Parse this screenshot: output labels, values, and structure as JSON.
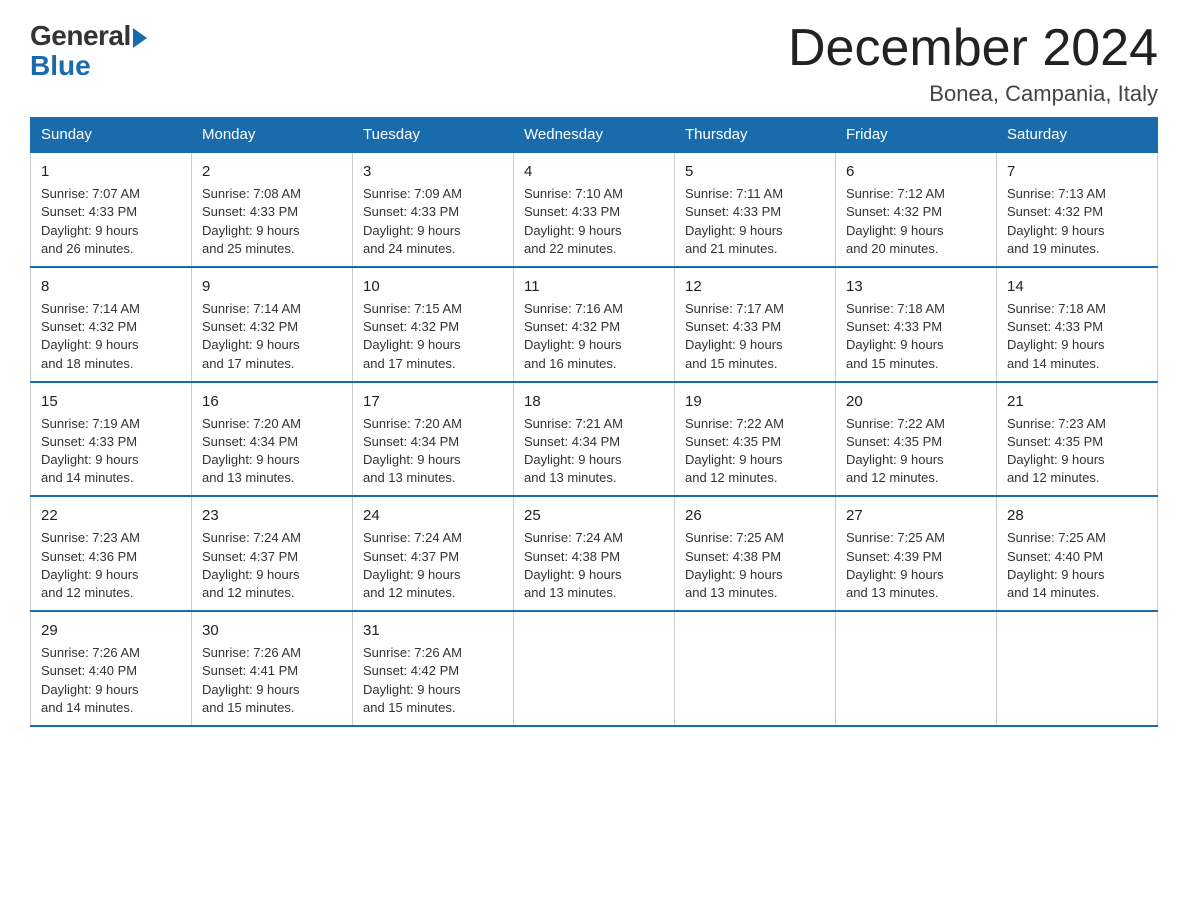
{
  "header": {
    "logo_general": "General",
    "logo_blue": "Blue",
    "month_title": "December 2024",
    "location": "Bonea, Campania, Italy"
  },
  "days_of_week": [
    "Sunday",
    "Monday",
    "Tuesday",
    "Wednesday",
    "Thursday",
    "Friday",
    "Saturday"
  ],
  "weeks": [
    [
      {
        "day": "1",
        "sunrise": "7:07 AM",
        "sunset": "4:33 PM",
        "daylight": "9 hours and 26 minutes."
      },
      {
        "day": "2",
        "sunrise": "7:08 AM",
        "sunset": "4:33 PM",
        "daylight": "9 hours and 25 minutes."
      },
      {
        "day": "3",
        "sunrise": "7:09 AM",
        "sunset": "4:33 PM",
        "daylight": "9 hours and 24 minutes."
      },
      {
        "day": "4",
        "sunrise": "7:10 AM",
        "sunset": "4:33 PM",
        "daylight": "9 hours and 22 minutes."
      },
      {
        "day": "5",
        "sunrise": "7:11 AM",
        "sunset": "4:33 PM",
        "daylight": "9 hours and 21 minutes."
      },
      {
        "day": "6",
        "sunrise": "7:12 AM",
        "sunset": "4:32 PM",
        "daylight": "9 hours and 20 minutes."
      },
      {
        "day": "7",
        "sunrise": "7:13 AM",
        "sunset": "4:32 PM",
        "daylight": "9 hours and 19 minutes."
      }
    ],
    [
      {
        "day": "8",
        "sunrise": "7:14 AM",
        "sunset": "4:32 PM",
        "daylight": "9 hours and 18 minutes."
      },
      {
        "day": "9",
        "sunrise": "7:14 AM",
        "sunset": "4:32 PM",
        "daylight": "9 hours and 17 minutes."
      },
      {
        "day": "10",
        "sunrise": "7:15 AM",
        "sunset": "4:32 PM",
        "daylight": "9 hours and 17 minutes."
      },
      {
        "day": "11",
        "sunrise": "7:16 AM",
        "sunset": "4:32 PM",
        "daylight": "9 hours and 16 minutes."
      },
      {
        "day": "12",
        "sunrise": "7:17 AM",
        "sunset": "4:33 PM",
        "daylight": "9 hours and 15 minutes."
      },
      {
        "day": "13",
        "sunrise": "7:18 AM",
        "sunset": "4:33 PM",
        "daylight": "9 hours and 15 minutes."
      },
      {
        "day": "14",
        "sunrise": "7:18 AM",
        "sunset": "4:33 PM",
        "daylight": "9 hours and 14 minutes."
      }
    ],
    [
      {
        "day": "15",
        "sunrise": "7:19 AM",
        "sunset": "4:33 PM",
        "daylight": "9 hours and 14 minutes."
      },
      {
        "day": "16",
        "sunrise": "7:20 AM",
        "sunset": "4:34 PM",
        "daylight": "9 hours and 13 minutes."
      },
      {
        "day": "17",
        "sunrise": "7:20 AM",
        "sunset": "4:34 PM",
        "daylight": "9 hours and 13 minutes."
      },
      {
        "day": "18",
        "sunrise": "7:21 AM",
        "sunset": "4:34 PM",
        "daylight": "9 hours and 13 minutes."
      },
      {
        "day": "19",
        "sunrise": "7:22 AM",
        "sunset": "4:35 PM",
        "daylight": "9 hours and 12 minutes."
      },
      {
        "day": "20",
        "sunrise": "7:22 AM",
        "sunset": "4:35 PM",
        "daylight": "9 hours and 12 minutes."
      },
      {
        "day": "21",
        "sunrise": "7:23 AM",
        "sunset": "4:35 PM",
        "daylight": "9 hours and 12 minutes."
      }
    ],
    [
      {
        "day": "22",
        "sunrise": "7:23 AM",
        "sunset": "4:36 PM",
        "daylight": "9 hours and 12 minutes."
      },
      {
        "day": "23",
        "sunrise": "7:24 AM",
        "sunset": "4:37 PM",
        "daylight": "9 hours and 12 minutes."
      },
      {
        "day": "24",
        "sunrise": "7:24 AM",
        "sunset": "4:37 PM",
        "daylight": "9 hours and 12 minutes."
      },
      {
        "day": "25",
        "sunrise": "7:24 AM",
        "sunset": "4:38 PM",
        "daylight": "9 hours and 13 minutes."
      },
      {
        "day": "26",
        "sunrise": "7:25 AM",
        "sunset": "4:38 PM",
        "daylight": "9 hours and 13 minutes."
      },
      {
        "day": "27",
        "sunrise": "7:25 AM",
        "sunset": "4:39 PM",
        "daylight": "9 hours and 13 minutes."
      },
      {
        "day": "28",
        "sunrise": "7:25 AM",
        "sunset": "4:40 PM",
        "daylight": "9 hours and 14 minutes."
      }
    ],
    [
      {
        "day": "29",
        "sunrise": "7:26 AM",
        "sunset": "4:40 PM",
        "daylight": "9 hours and 14 minutes."
      },
      {
        "day": "30",
        "sunrise": "7:26 AM",
        "sunset": "4:41 PM",
        "daylight": "9 hours and 15 minutes."
      },
      {
        "day": "31",
        "sunrise": "7:26 AM",
        "sunset": "4:42 PM",
        "daylight": "9 hours and 15 minutes."
      },
      null,
      null,
      null,
      null
    ]
  ]
}
